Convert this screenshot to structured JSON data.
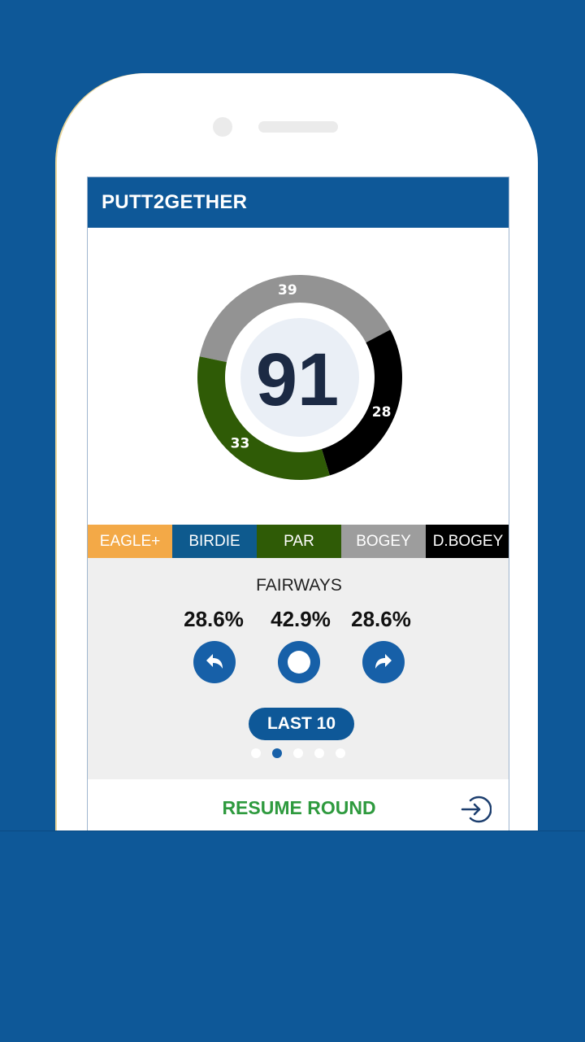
{
  "app": {
    "title": "PUTT2GETHER"
  },
  "score": {
    "total": "91",
    "segments": [
      {
        "name": "gray",
        "value": 39,
        "label": "39",
        "color": "#939393"
      },
      {
        "name": "black",
        "value": 28,
        "label": "28",
        "color": "#000000"
      },
      {
        "name": "green",
        "value": 33,
        "label": "33",
        "color": "#2f5b06"
      }
    ]
  },
  "legend": [
    {
      "label": "EAGLE+",
      "color": "#f3a947"
    },
    {
      "label": "BIRDIE",
      "color": "#0e5a8e"
    },
    {
      "label": "PAR",
      "color": "#2f5b06"
    },
    {
      "label": "BOGEY",
      "color": "#9d9d9d"
    },
    {
      "label": "D.BOGEY",
      "color": "#000000"
    }
  ],
  "fairways": {
    "heading": "FAIRWAYS",
    "left": "28.6%",
    "center": "42.9%",
    "right": "28.6%",
    "icons": [
      "arrow-left-icon",
      "circle-center-icon",
      "arrow-right-icon"
    ]
  },
  "range_button": {
    "label": "LAST 10"
  },
  "pager": {
    "count": 5,
    "active_index": 1
  },
  "resume": {
    "label": "RESUME ROUND",
    "icon": "sign-in-icon"
  }
}
